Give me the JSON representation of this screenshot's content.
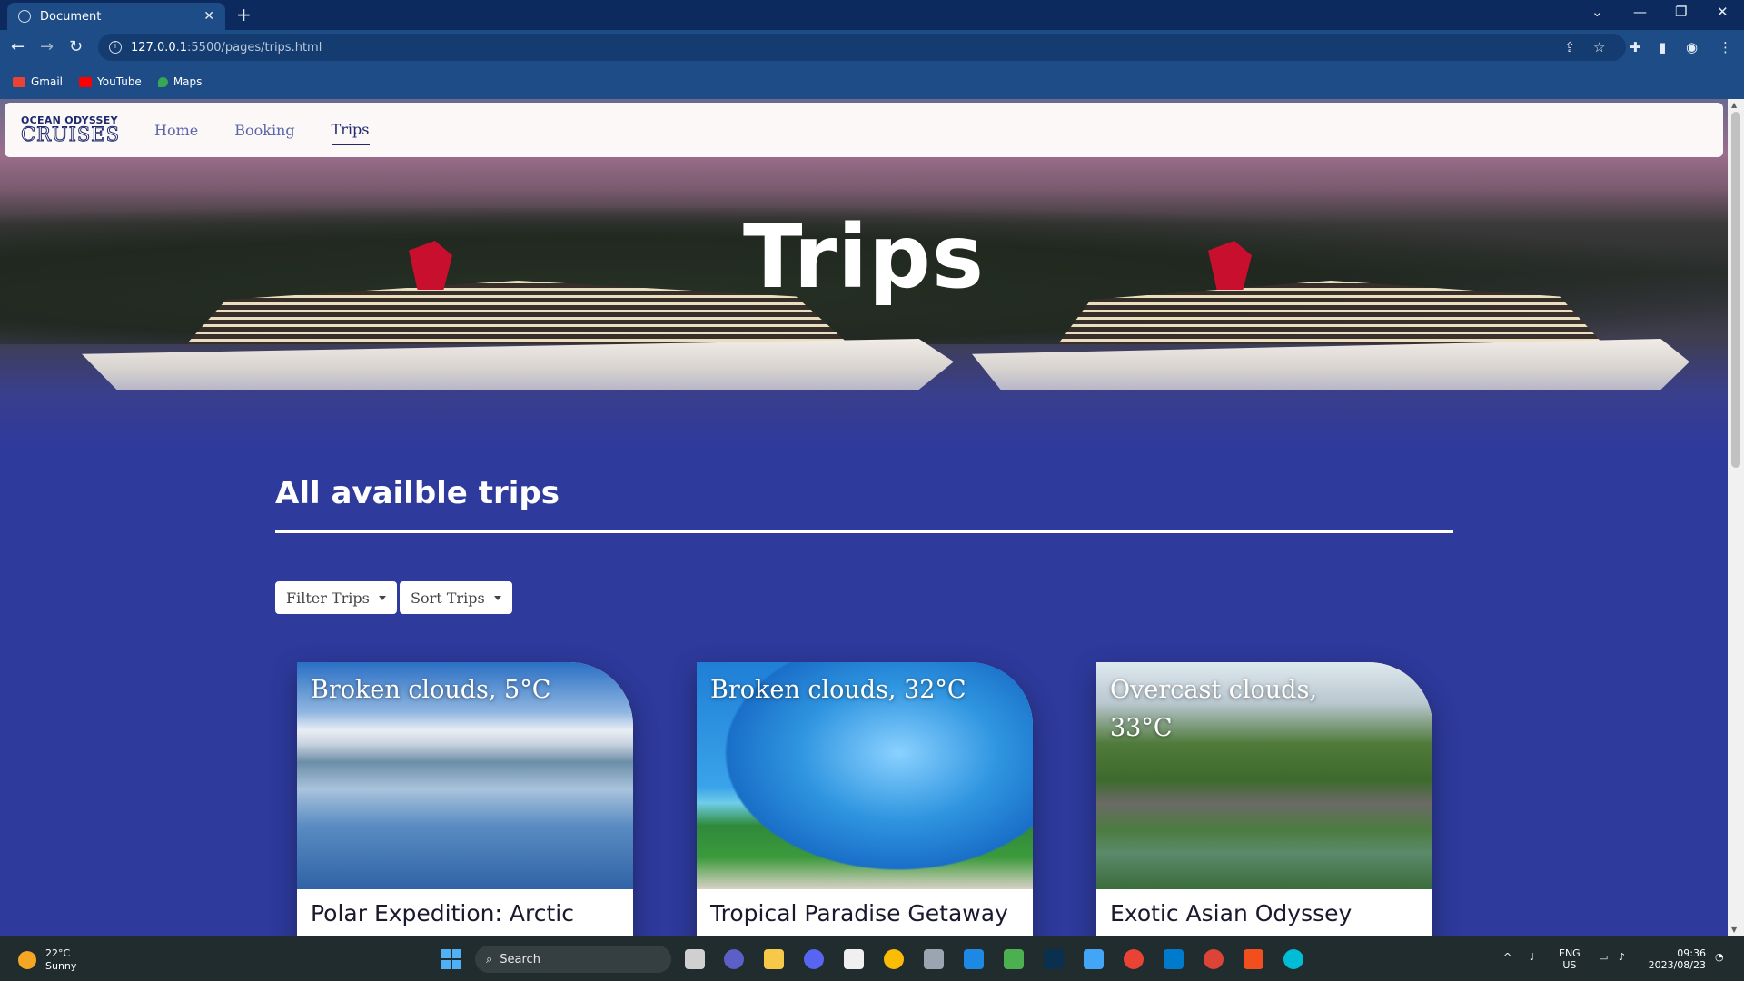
{
  "browser": {
    "tab_title": "Document",
    "tab_close": "✕",
    "new_tab": "+",
    "url_host": "127.0.0.1",
    "url_path": ":5500/pages/trips.html",
    "bookmarks": [
      {
        "label": "Gmail",
        "icon": "gmail-icon",
        "color": "#ea4335"
      },
      {
        "label": "YouTube",
        "icon": "youtube-icon",
        "color": "#ff0000"
      },
      {
        "label": "Maps",
        "icon": "maps-icon",
        "color": "#34a853"
      }
    ]
  },
  "site": {
    "logo_line1": "OCEAN ODYSSEY",
    "logo_line2": "CRUISES",
    "nav": [
      {
        "label": "Home"
      },
      {
        "label": "Booking"
      },
      {
        "label": "Trips",
        "active": true
      }
    ],
    "hero_title": "Trips",
    "section_title": "All availble trips",
    "filter_label": "Filter Trips",
    "sort_label": "Sort Trips",
    "trips": [
      {
        "weather": "Broken clouds, 5°C",
        "name": "Polar Expedition: Arctic"
      },
      {
        "weather": "Broken clouds, 32°C",
        "name": "Tropical Paradise Getaway"
      },
      {
        "weather": "Overcast clouds, 33°C",
        "name": "Exotic Asian Odyssey"
      }
    ]
  },
  "taskbar": {
    "temp": "22°C",
    "condition": "Sunny",
    "search": "Search",
    "lang1": "ENG",
    "lang2": "US",
    "time": "09:36",
    "date": "2023/08/23"
  },
  "colors": {
    "page_bg": "#2e3a9c",
    "nav_text": "#1f2a6e",
    "browser_frame": "#1d4c86"
  }
}
